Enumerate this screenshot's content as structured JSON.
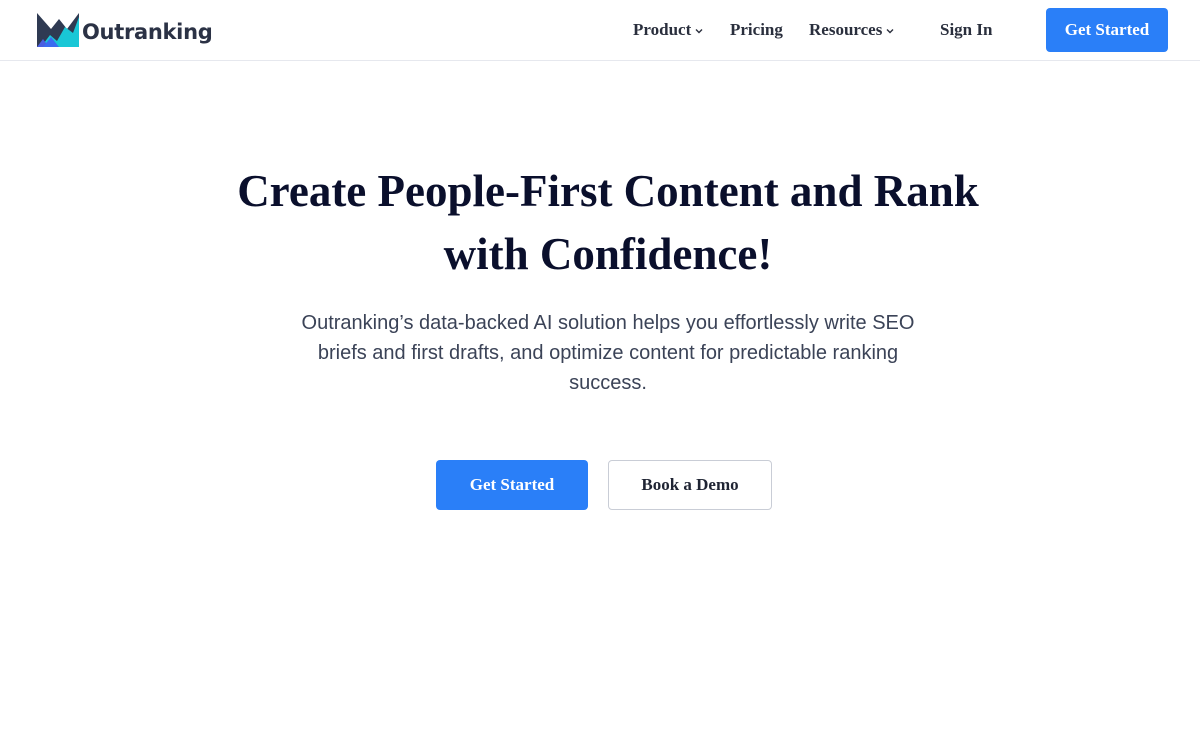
{
  "brand": {
    "name": "Outranking",
    "colors": {
      "primary": "#2a7ff8",
      "heading": "#0a0f2c",
      "body_text": "#3b4357",
      "logo_text": "#2b3245"
    }
  },
  "nav": {
    "items": [
      {
        "label": "Product",
        "has_dropdown": true,
        "icon": "chevron-down-icon"
      },
      {
        "label": "Pricing",
        "has_dropdown": false
      },
      {
        "label": "Resources",
        "has_dropdown": true,
        "icon": "chevron-down-icon"
      }
    ],
    "sign_in_label": "Sign In",
    "cta_label": "Get Started"
  },
  "hero": {
    "title": "Create People-First Content and Rank with Confidence!",
    "subtitle": "Outranking’s data-backed AI solution helps you effortlessly write SEO briefs and first drafts, and optimize content for predictable ranking success.",
    "primary_cta": "Get Started",
    "secondary_cta": "Book a Demo"
  }
}
